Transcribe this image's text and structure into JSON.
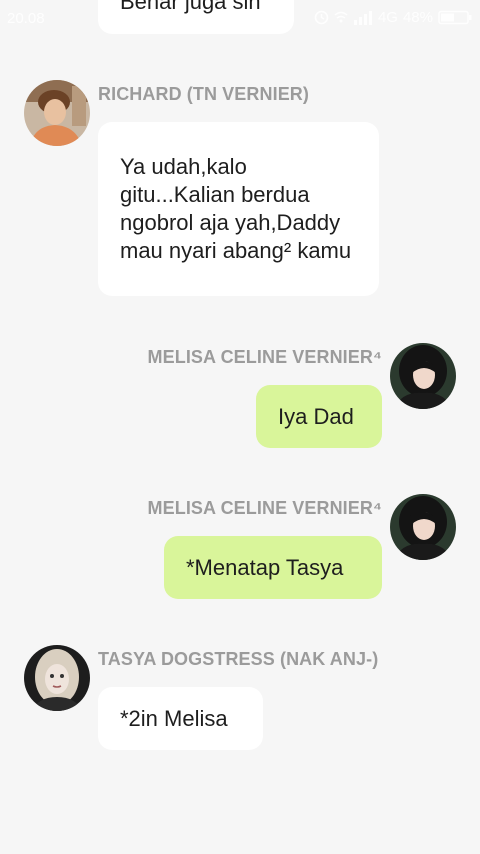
{
  "status_bar": {
    "time": "20.08",
    "network": "4G",
    "battery": "48%"
  },
  "messages": [
    {
      "sender": "",
      "text": "Benar juga sih",
      "side": "left"
    },
    {
      "sender": "RICHARD (TN VERNIER)",
      "text": "Ya udah,kalo gitu...Kalian berdua ngobrol aja yah,Daddy mau nyari abang² kamu",
      "side": "left"
    },
    {
      "sender": "MELISA CELINE VERNIER⁴",
      "text": "Iya Dad",
      "side": "right"
    },
    {
      "sender": "MELISA CELINE VERNIER⁴",
      "text": "*Menatap Tasya",
      "side": "right"
    },
    {
      "sender": "TASYA DOGSTRESS (NAK ANJ-)",
      "text": "*2in Melisa",
      "side": "left"
    }
  ]
}
